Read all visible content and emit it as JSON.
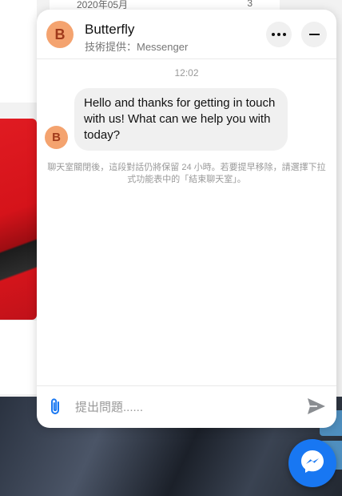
{
  "background": {
    "archive_date": "2020年05月",
    "archive_count": "3"
  },
  "chat": {
    "avatar_letter": "B",
    "title": "Butterfly",
    "subtitle": "技術提供：Messenger",
    "more_icon": "more-horizontal-icon",
    "minimize_icon": "minimize-icon",
    "timestamp": "12:02",
    "messages": [
      {
        "sender": "Butterfly",
        "text": "Hello and thanks for getting in touch with us! What can we help you with today?"
      }
    ],
    "notice": "聊天室關閉後，這段對話仍將保留 24 小時。若要提早移除，請選擇下拉式功能表中的「結束聊天室」。",
    "input_placeholder": "提出問題......",
    "attach_icon": "paperclip-icon",
    "send_icon": "send-icon"
  },
  "messenger_fab_icon": "messenger-icon",
  "colors": {
    "accent": "#1877f2",
    "avatar_bg": "#f4a36f",
    "bubble_bg": "#f0f0f0"
  }
}
